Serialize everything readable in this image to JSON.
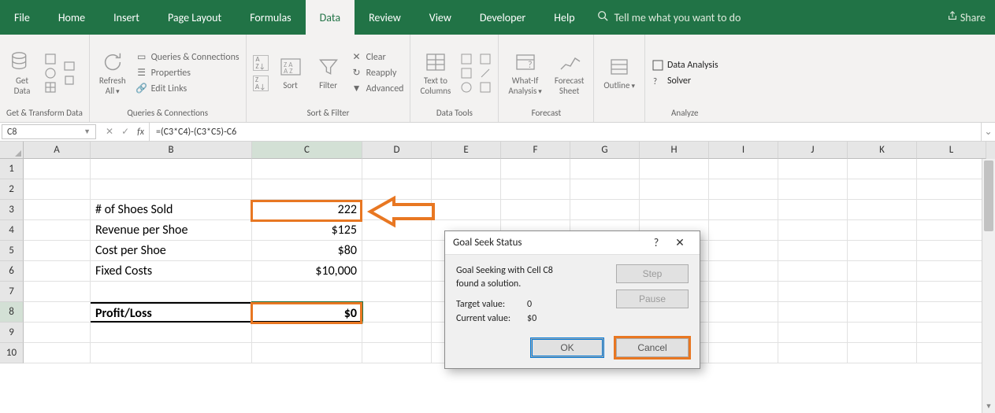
{
  "tabs": {
    "file": "File",
    "home": "Home",
    "insert": "Insert",
    "page_layout": "Page Layout",
    "formulas": "Formulas",
    "data": "Data",
    "review": "Review",
    "view": "View",
    "developer": "Developer",
    "help": "Help",
    "tell_me": "Tell me what you want to do",
    "share": "Share"
  },
  "ribbon": {
    "get_data": "Get\nData",
    "group_get": "Get & Transform Data",
    "refresh_all": "Refresh\nAll",
    "queries": "Queries & Connections",
    "properties": "Properties",
    "edit_links": "Edit Links",
    "group_conn": "Queries & Connections",
    "sort": "Sort",
    "filter": "Filter",
    "clear": "Clear",
    "reapply": "Reapply",
    "advanced": "Advanced",
    "group_sortfilter": "Sort & Filter",
    "text_to_columns": "Text to\nColumns",
    "group_datatools": "Data Tools",
    "what_if": "What-If\nAnalysis",
    "forecast_sheet": "Forecast\nSheet",
    "group_forecast": "Forecast",
    "outline": "Outline",
    "data_analysis": "Data Analysis",
    "solver": "Solver",
    "group_analyze": "Analyze"
  },
  "formula_bar": {
    "name_box": "C8",
    "formula": "=(C3*C4)-(C3*C5)-C6"
  },
  "columns": [
    "A",
    "B",
    "C",
    "D",
    "E",
    "F",
    "G",
    "H",
    "I",
    "J",
    "K",
    "L"
  ],
  "cells": {
    "B3": "# of Shoes Sold",
    "C3": "222",
    "B4": "Revenue per Shoe",
    "C4": "$125",
    "B5": "Cost per Shoe",
    "C5": "$80",
    "B6": "Fixed Costs",
    "C6": "$10,000",
    "B8": "Profit/Loss",
    "C8": "$0"
  },
  "dialog": {
    "title": "Goal Seek Status",
    "line1": "Goal Seeking with Cell C8",
    "line2": "found a solution.",
    "target_label": "Target value:",
    "target_value": "0",
    "current_label": "Current value:",
    "current_value": "$0",
    "step": "Step",
    "pause": "Pause",
    "ok": "OK",
    "cancel": "Cancel"
  },
  "chart_data": {
    "type": "table",
    "title": "Goal Seek break-even model",
    "rows": [
      {
        "label": "# of Shoes Sold",
        "value": 222
      },
      {
        "label": "Revenue per Shoe",
        "value": 125,
        "unit": "$"
      },
      {
        "label": "Cost per Shoe",
        "value": 80,
        "unit": "$"
      },
      {
        "label": "Fixed Costs",
        "value": 10000,
        "unit": "$"
      },
      {
        "label": "Profit/Loss",
        "value": 0,
        "unit": "$",
        "formula": "=(C3*C4)-(C3*C5)-C6"
      }
    ],
    "goal_seek": {
      "cell": "C8",
      "target_value": 0,
      "current_value": 0,
      "changing_cell": "C3"
    }
  }
}
